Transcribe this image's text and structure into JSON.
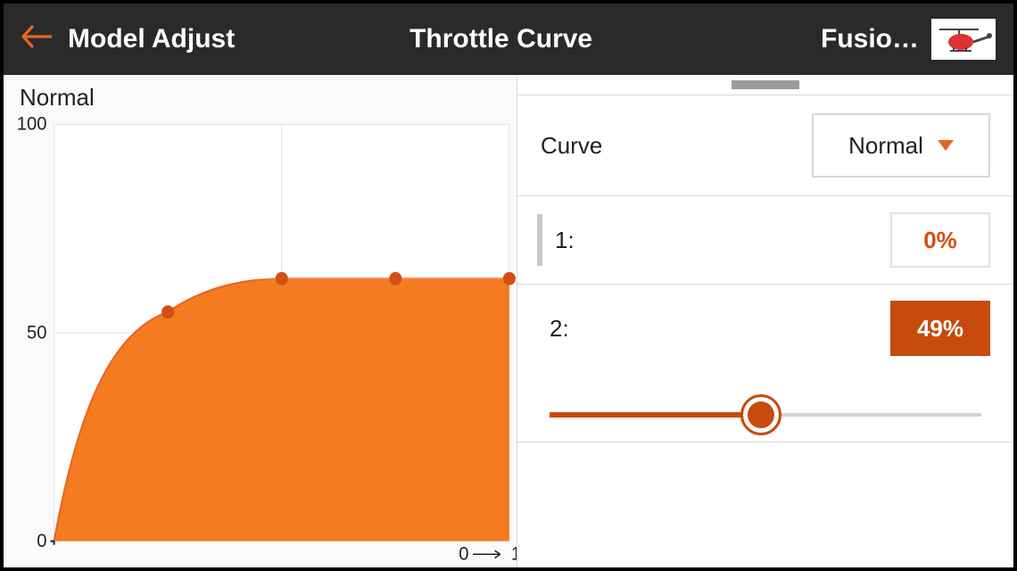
{
  "header": {
    "back_label": "Model Adjust",
    "title": "Throttle Curve",
    "model_name": "Fusio…"
  },
  "chart_data": {
    "type": "area",
    "title": "Normal",
    "x": [
      0,
      25,
      50,
      75,
      100
    ],
    "values": [
      0,
      55,
      63,
      63,
      63
    ],
    "ylim": [
      0,
      100
    ],
    "xlim": [
      0,
      100
    ],
    "yticks": [
      0,
      50,
      100
    ],
    "x_axis_marker": "0 → 1"
  },
  "panel": {
    "curve_label": "Curve",
    "curve_value": "Normal",
    "points": [
      {
        "label": "1:",
        "value": "0%",
        "active": false
      },
      {
        "label": "2:",
        "value": "49%",
        "active": true
      }
    ],
    "slider_percent": 49
  }
}
